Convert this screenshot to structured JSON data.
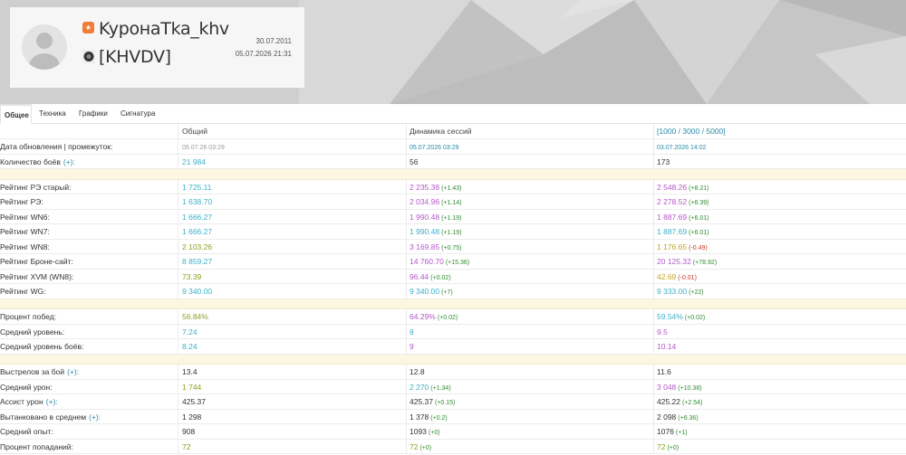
{
  "profile": {
    "nickname": "KypoнaTka_khv",
    "clan": "[KHVDV]",
    "registered": "30.07.2011",
    "last_battle": "05.07.2026 21:31",
    "badge_icon": "star-badge-icon",
    "colors": {
      "badge": "#f07c3a"
    }
  },
  "tabs": [
    {
      "label": "Общее",
      "active": true
    },
    {
      "label": "Техника",
      "active": false
    },
    {
      "label": "Графики",
      "active": false
    },
    {
      "label": "Сигнатура",
      "active": false
    }
  ],
  "table": {
    "headers": [
      "",
      "Общий",
      "Динамика сессий",
      "[1000 / 3000 / 5000]"
    ],
    "rows": [
      {
        "label": "Дата обновления | промежуток:",
        "c1": "05.07.26 03:29",
        "c1cls": "gray small",
        "c2": "05.07.2026 03:29",
        "c2cls": "teal small",
        "c3": "03.07.2026 14:02",
        "c3cls": "teal small"
      },
      {
        "label": "Количество боёв",
        "plus": "(+):",
        "c1": "21 984",
        "c1cls": "blue",
        "c2": "56",
        "c2cls": "",
        "c3": "173",
        "c3cls": ""
      },
      {
        "sep": true
      },
      {
        "label": "Рейтинг РЭ старый:",
        "c1": "1 725.11",
        "c1cls": "blue",
        "c2": "2 235.38",
        "c2cls": "purple",
        "d2": "(+1.43)",
        "c3": "2 548.26",
        "c3cls": "purple",
        "d3": "(+8.21)"
      },
      {
        "label": "Рейтинг РЭ:",
        "c1": "1 638.70",
        "c1cls": "blue",
        "c2": "2 034.96",
        "c2cls": "purple",
        "d2": "(+1.14)",
        "c3": "2 278.52",
        "c3cls": "purple",
        "d3": "(+6.39)"
      },
      {
        "label": "Рейтинг WN6:",
        "c1": "1 666.27",
        "c1cls": "blue",
        "c2": "1 990.48",
        "c2cls": "purple",
        "d2": "(+1.19)",
        "c3": "1 887.69",
        "c3cls": "purple",
        "d3": "(+6.01)"
      },
      {
        "label": "Рейтинг WN7:",
        "c1": "1 666.27",
        "c1cls": "blue",
        "c2": "1 990.48",
        "c2cls": "blue",
        "d2": "(+1.19)",
        "c3": "1 887.69",
        "c3cls": "blue",
        "d3": "(+6.01)"
      },
      {
        "label": "Рейтинг WN8:",
        "c1": "2 103.26",
        "c1cls": "green",
        "c2": "3 169.85",
        "c2cls": "purple",
        "d2": "(+0.75)",
        "c3": "1 176.65",
        "c3cls": "gold",
        "d3": "(-0.49)",
        "d3neg": true
      },
      {
        "label": "Рейтинг Броне-сайт:",
        "c1": "8 859.27",
        "c1cls": "blue",
        "c2": "14 760.70",
        "c2cls": "purple",
        "d2": "(+15.36)",
        "c3": "20 125.32",
        "c3cls": "purple",
        "d3": "(+78.92)"
      },
      {
        "label": "Рейтинг XVM (WN8):",
        "c1": "73.39",
        "c1cls": "green",
        "c2": "96.44",
        "c2cls": "purple",
        "d2": "(+0.02)",
        "c3": "42.69",
        "c3cls": "gold",
        "d3": "(-0.01)",
        "d3neg": true
      },
      {
        "label": "Рейтинг WG:",
        "c1": "9 340.00",
        "c1cls": "blue",
        "c2": "9 340.00",
        "c2cls": "blue",
        "d2": "(+7)",
        "c3": "9 333.00",
        "c3cls": "blue",
        "d3": "(+22)"
      },
      {
        "sep": true
      },
      {
        "label": "Процент побед:",
        "c1": "56.84%",
        "c1cls": "green",
        "c2": "64.29%",
        "c2cls": "purple",
        "d2": "(+0.02)",
        "c3": "59.54%",
        "c3cls": "blue",
        "d3": "(+0.02)"
      },
      {
        "label": "Средний уровень:",
        "c1": "7.24",
        "c1cls": "blue",
        "c2": "8",
        "c2cls": "blue",
        "c3": "9.5",
        "c3cls": "purple"
      },
      {
        "label": "Средний уровень боёв:",
        "c1": "8.24",
        "c1cls": "blue",
        "c2": "9",
        "c2cls": "purple",
        "c3": "10.14",
        "c3cls": "purple"
      },
      {
        "sep": true
      },
      {
        "label": "Выстрелов за бой",
        "plus": "(+):",
        "c1": "13.4",
        "c1cls": "",
        "c2": "12.8",
        "c2cls": "",
        "c3": "11.6",
        "c3cls": ""
      },
      {
        "label": "Средний урон:",
        "c1": "1 744",
        "c1cls": "green",
        "c2": "2 270",
        "c2cls": "blue",
        "d2": "(+1.34)",
        "c3": "3 048",
        "c3cls": "purple",
        "d3": "(+10.38)"
      },
      {
        "label": "Ассист урон",
        "plus": "(+):",
        "c1": "425.37",
        "c1cls": "",
        "c2": "425.37",
        "c2cls": "",
        "d2": "(+0.15)",
        "c3": "425.22",
        "c3cls": "",
        "d3": "(+2.54)"
      },
      {
        "label": "Вытанковано в среднем",
        "plus": "(+):",
        "c1": "1 298",
        "c1cls": "",
        "c2": "1 378",
        "c2cls": "",
        "d2": "(+0.2)",
        "c3": "2 098",
        "c3cls": "",
        "d3": "(+6.36)"
      },
      {
        "label": "Средний опыт:",
        "c1": "908",
        "c1cls": "",
        "c2": "1093",
        "c2cls": "",
        "d2": "(+0)",
        "c3": "1076",
        "c3cls": "",
        "d3": "(+1)"
      },
      {
        "label": "Процент попаданий:",
        "c1": "72",
        "c1cls": "green",
        "c2": "72",
        "c2cls": "green",
        "d2": "(+0)",
        "c3": "72",
        "c3cls": "green",
        "d3": "(+0)"
      }
    ]
  }
}
